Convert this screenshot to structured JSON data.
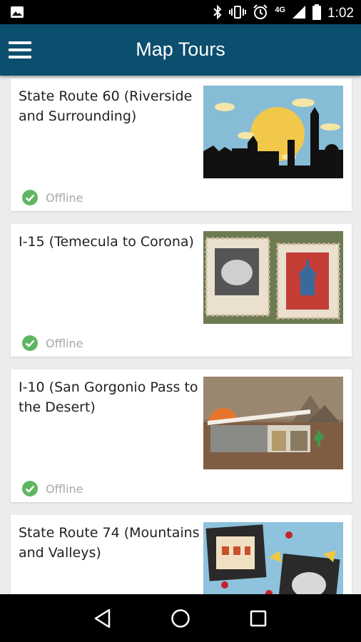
{
  "status_bar": {
    "time": "1:02",
    "network": "4G",
    "icons": [
      "image-icon",
      "bluetooth-icon",
      "vibrate-icon",
      "alarm-icon",
      "signal-icon",
      "battery-icon"
    ]
  },
  "app_bar": {
    "title": "Map Tours",
    "menu_icon": "hamburger-menu-icon"
  },
  "tours": [
    {
      "title": "State Route 60 (Riverside and Surrounding)",
      "status": "Offline"
    },
    {
      "title": "I-15 (Temecula to Corona)",
      "status": "Offline"
    },
    {
      "title": "I-10 (San Gorgonio Pass to the Desert)",
      "status": "Offline"
    },
    {
      "title": "State Route 74 (Mountains and Valleys)",
      "status": ""
    }
  ],
  "colors": {
    "app_bar": "#0b4e6e",
    "offline_check": "#5fb662",
    "background": "#ececec"
  },
  "nav_bar": {
    "icons": [
      "back-icon",
      "home-icon",
      "recents-icon"
    ]
  }
}
